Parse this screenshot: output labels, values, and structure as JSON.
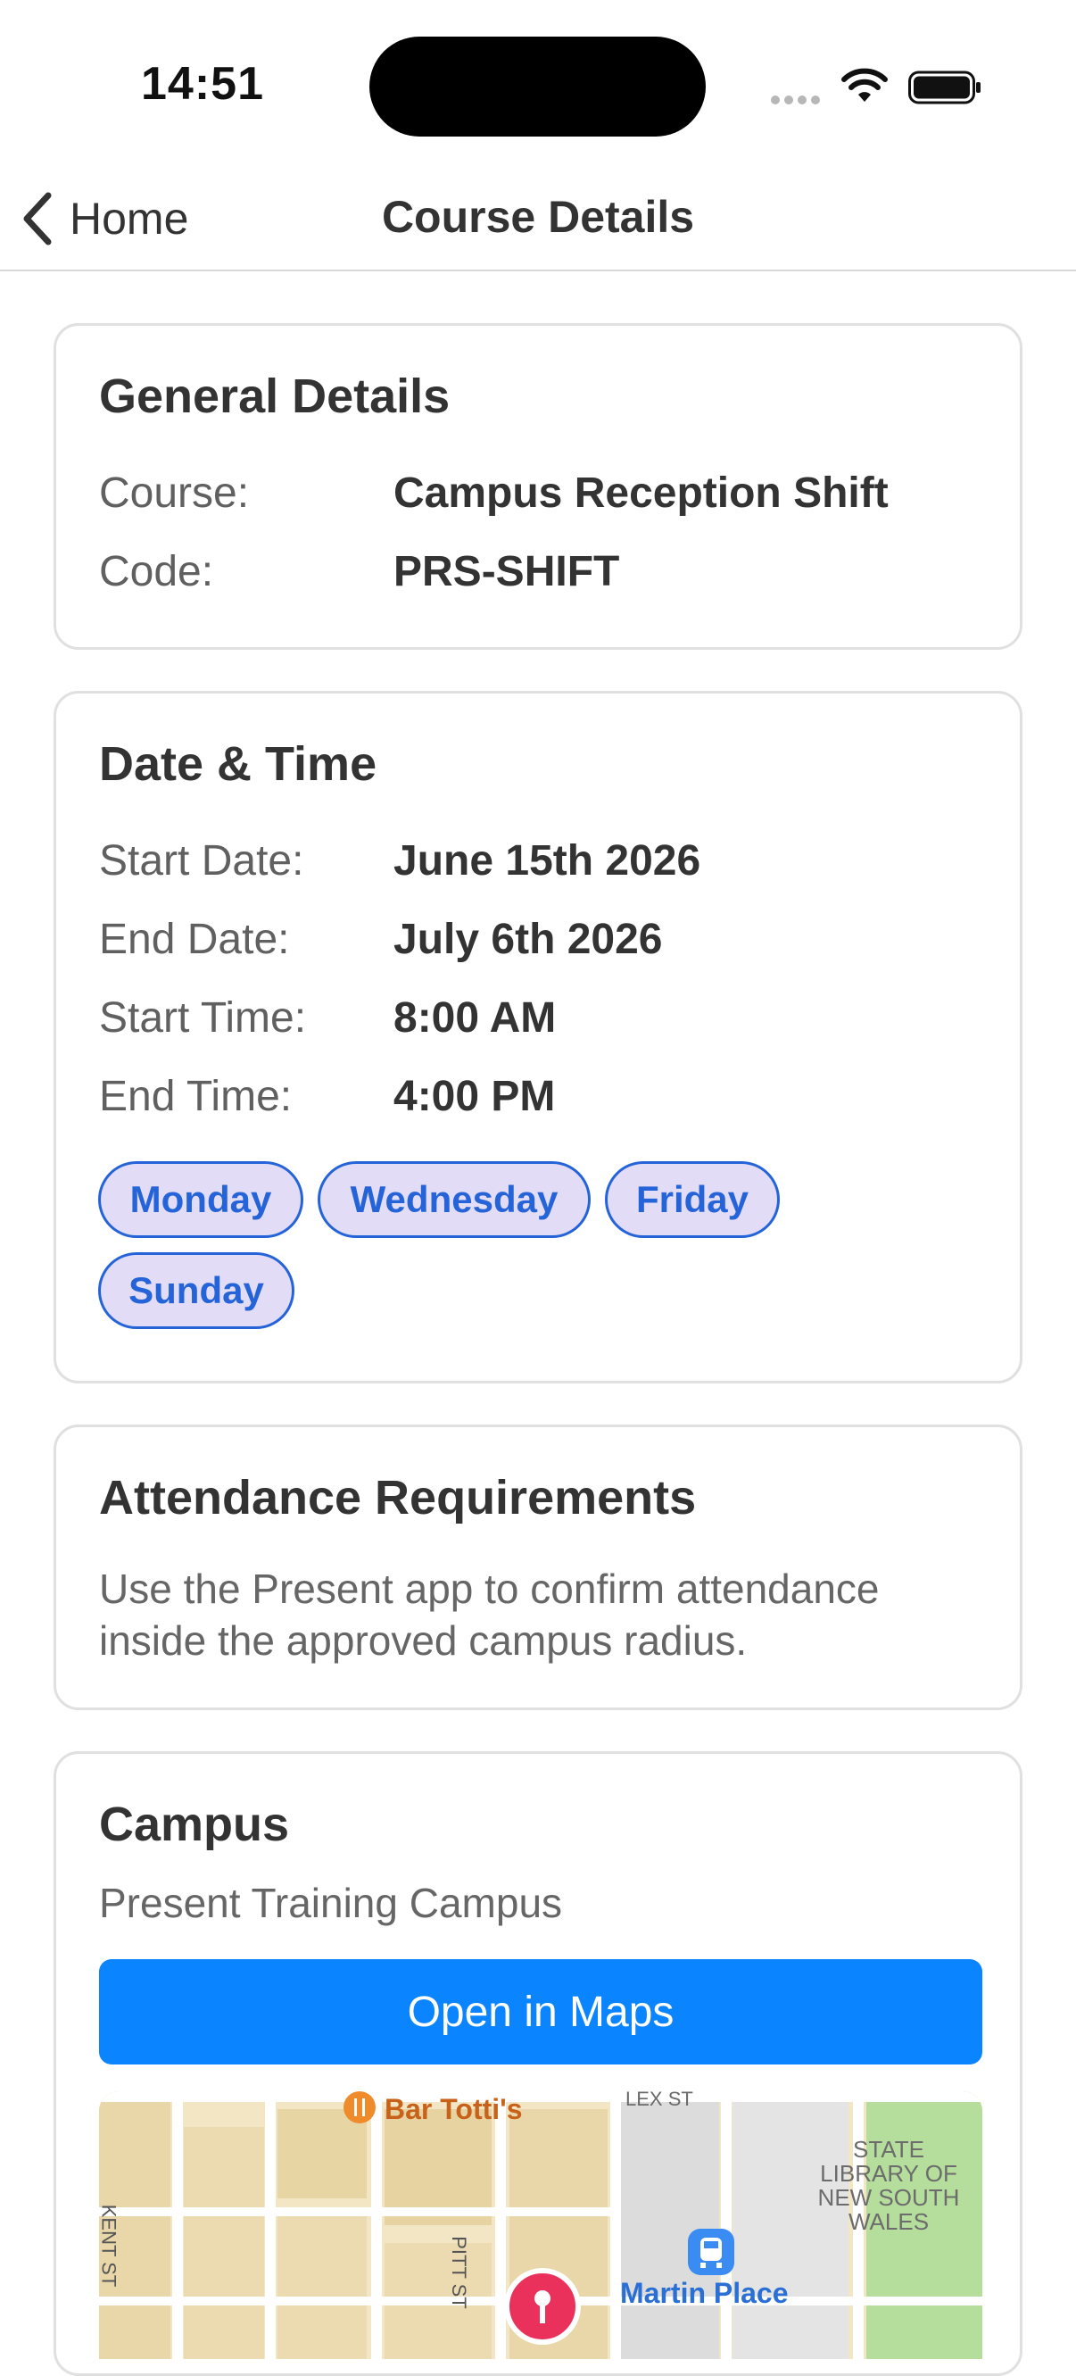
{
  "status_bar": {
    "time": "14:51"
  },
  "nav": {
    "back_label": "Home",
    "title": "Course Details"
  },
  "general": {
    "title": "General Details",
    "rows": [
      {
        "label": "Course:",
        "value": "Campus Reception Shift"
      },
      {
        "label": "Code:",
        "value": "PRS-SHIFT"
      }
    ]
  },
  "datetime": {
    "title": "Date & Time",
    "rows": [
      {
        "label": "Start Date:",
        "value": "June 15th 2026"
      },
      {
        "label": "End Date:",
        "value": "July 6th 2026"
      },
      {
        "label": "Start Time:",
        "value": "8:00 AM"
      },
      {
        "label": "End Time:",
        "value": "4:00 PM"
      }
    ],
    "days": [
      "Monday",
      "Wednesday",
      "Friday",
      "Sunday"
    ]
  },
  "attendance": {
    "title": "Attendance Requirements",
    "text": "Use the Present app to confirm attendance inside the approved campus radius."
  },
  "campus": {
    "title": "Campus",
    "name": "Present Training Campus",
    "button_label": "Open in Maps",
    "map": {
      "poi_restaurant": "Bar Totti's",
      "street_kent": "KENT ST",
      "street_pitt": "PITT ST",
      "street_top": "LEX ST",
      "library": "STATE LIBRARY OF NEW SOUTH WALES",
      "station": "Martin Place"
    }
  },
  "colors": {
    "accent": "#0a84ff",
    "chip_border": "#2563d8",
    "chip_fill": "#e2dcf7"
  },
  "icons": {
    "back": "chevron-left-icon",
    "wifi": "wifi-icon",
    "battery": "battery-icon",
    "pin": "map-pin-icon",
    "train": "train-icon",
    "restaurant": "fork-knife-icon"
  }
}
